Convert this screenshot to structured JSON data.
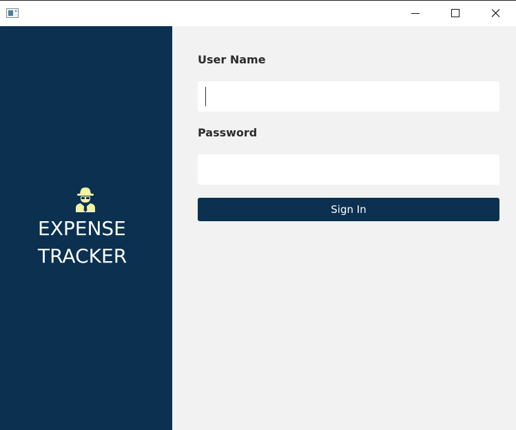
{
  "window": {
    "controls": {
      "minimize_icon": "minimize-icon",
      "maximize_icon": "maximize-icon",
      "close_icon": "close-icon"
    },
    "app_icon": "window-app-icon"
  },
  "sidebar": {
    "logo_icon": "spy-agent-icon",
    "logo_color": "#f0f3a4",
    "title_line1": "EXPENSE",
    "title_line2": "TRACKER",
    "background": "#0b3050"
  },
  "form": {
    "username_label": "User Name",
    "username_value": "",
    "password_label": "Password",
    "password_value": "",
    "signin_label": "Sign In",
    "accent": "#0b3050"
  }
}
